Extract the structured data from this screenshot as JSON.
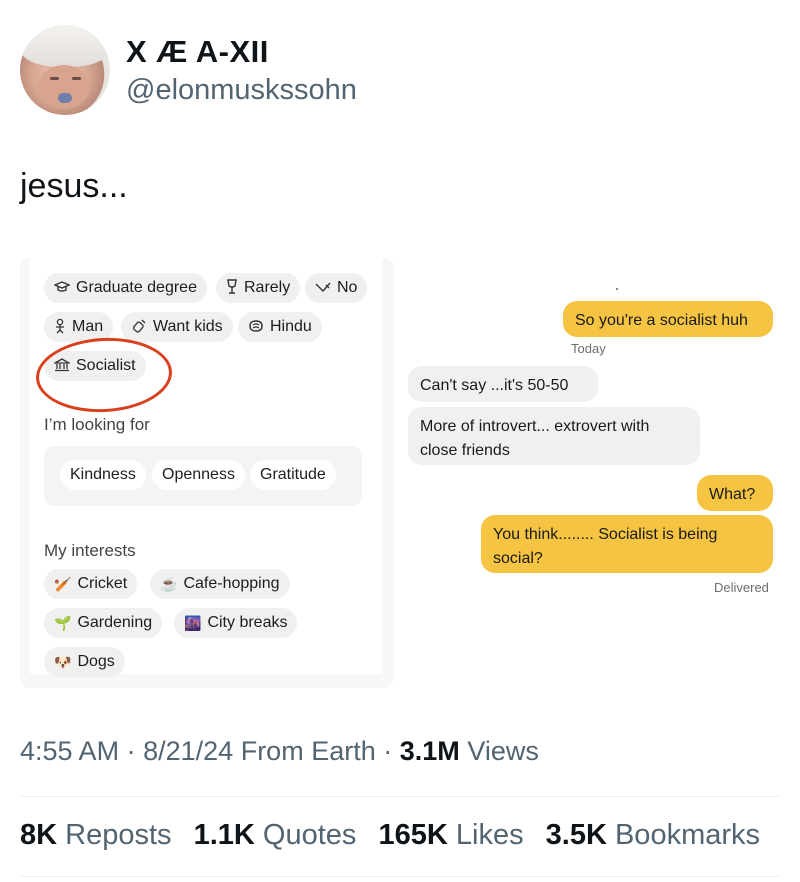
{
  "author": {
    "display_name": "X Æ A-XII",
    "handle": "@elonmuskssohn"
  },
  "tweet": {
    "text": "jesus..."
  },
  "profile_card": {
    "chips_row1": [
      {
        "icon": "graduation-cap-icon",
        "label": "Graduate degree"
      },
      {
        "icon": "wine-glass-icon",
        "label": "Rarely"
      },
      {
        "icon": "smoking-icon",
        "label": "No"
      }
    ],
    "chips_row2": [
      {
        "icon": "person-icon",
        "label": "Man"
      },
      {
        "icon": "baby-bottle-icon",
        "label": "Want kids"
      },
      {
        "icon": "religion-icon",
        "label": "Hindu"
      }
    ],
    "chips_row3": [
      {
        "icon": "government-building-icon",
        "label": "Socialist"
      }
    ],
    "looking_for_label": "I’m looking for",
    "looking_for": [
      "Kindness",
      "Openness",
      "Gratitude"
    ],
    "interests_label": "My interests",
    "interests": [
      {
        "icon": "cricket-icon",
        "emoji": "🏏",
        "label": "Cricket"
      },
      {
        "icon": "coffee-icon",
        "emoji": "☕",
        "label": "Cafe-hopping"
      },
      {
        "icon": "seedling-icon",
        "emoji": "🌱",
        "label": "Gardening"
      },
      {
        "icon": "city-icon",
        "emoji": "🌆",
        "label": "City breaks"
      },
      {
        "icon": "dog-icon",
        "emoji": "🐶",
        "label": "Dogs"
      }
    ],
    "highlight_color": "#d9401e"
  },
  "chat": {
    "messages": [
      {
        "direction": "out",
        "text": "So you're a socialist huh"
      },
      {
        "direction": "meta",
        "text": "Today"
      },
      {
        "direction": "in",
        "text": "Can't say ...it's 50-50"
      },
      {
        "direction": "in",
        "text": "More of introvert... extrovert with close friends"
      },
      {
        "direction": "out",
        "text": "What?"
      },
      {
        "direction": "out",
        "text": "You think........ Socialist is being social?"
      },
      {
        "direction": "meta",
        "text": "Delivered"
      }
    ],
    "outgoing_color": "#f6c443",
    "incoming_color": "#f0f0f0"
  },
  "footer": {
    "time": "4:55 AM",
    "date": "8/21/24",
    "source": "From Earth",
    "views_count": "3.1M",
    "views_label": "Views",
    "reposts_count": "8K",
    "reposts_label": "Reposts",
    "quotes_count": "1.1K",
    "quotes_label": "Quotes",
    "likes_count": "165K",
    "likes_label": "Likes",
    "bookmarks_count": "3.5K",
    "bookmarks_label": "Bookmarks"
  }
}
